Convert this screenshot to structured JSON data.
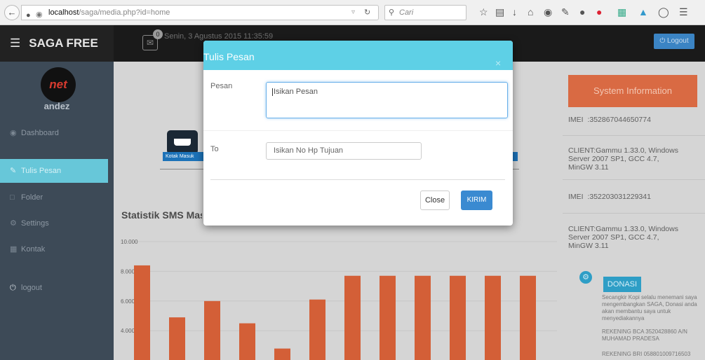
{
  "browser": {
    "url_host": "localhost",
    "url_path": "/saga/media.php?id=home",
    "search_placeholder": "Cari",
    "back_icon": "back-arrow-icon"
  },
  "app": {
    "brand": "SAGA FREE",
    "menu_icon": "hamburger-icon",
    "inbox_badge": "0",
    "datetime": "Senin, 3 Agustus 2015 11:35:59",
    "logout_button": "Logout"
  },
  "sidebar": {
    "user_name": "andez",
    "avatar_text": "net",
    "items": [
      {
        "label": "Dashboard",
        "icon": "dashboard-icon"
      },
      {
        "label": "Tulis Pesan",
        "icon": "edit-icon",
        "active": true
      },
      {
        "label": "Folder",
        "icon": "folder-icon"
      },
      {
        "label": "Settings",
        "icon": "gears-icon"
      },
      {
        "label": "Kontak",
        "icon": "book-icon"
      },
      {
        "label": "logout",
        "icon": "power-icon"
      }
    ]
  },
  "main": {
    "inbox_label": "Kotak Masuk",
    "stat_title": "Statistik SMS Masuk"
  },
  "chart_data": {
    "type": "bar",
    "yticks": [
      "10.000",
      "8.000",
      "6.000",
      "4.000"
    ],
    "ylim": [
      0,
      10000
    ],
    "values": [
      8400,
      4900,
      6000,
      4500,
      2800,
      6100,
      7700,
      7700,
      7700,
      7700,
      7700,
      7700
    ],
    "colors": {
      "bar": "#d35f37",
      "grid": "#c6c6c6"
    }
  },
  "right_panel": {
    "title": "System Information",
    "rows": [
      {
        "label": "IMEI",
        "value": ":352867044650774"
      },
      {
        "label": "CLIENT",
        "value": ":Gammu 1.33.0, Windows Server 2007 SP1, GCC 4.7, MinGW 3.11"
      },
      {
        "label": "IMEI",
        "value": ":352203031229341"
      },
      {
        "label": "CLIENT",
        "value": ":Gammu 1.33.0, Windows Server 2007 SP1, GCC 4.7, MinGW 3.11"
      }
    ],
    "donasi_button": "DONASI",
    "donasi_text": "Secangkir Kopi selalu menemani saya mengembangkan SAGA, Donasi anda akan membantu saya untuk menyediakannya",
    "rekening_1": "REKENING BCA 3520428860 A/N MUHAMAD PRADESA",
    "rekening_2": "REKENING BRI 058801009716503"
  },
  "modal": {
    "title": "Tulis Pesan",
    "close_x": "×",
    "pesan_label": "Pesan",
    "pesan_placeholder": "Isikan Pesan",
    "to_label": "To",
    "to_placeholder": "Isikan No Hp Tujuan",
    "close_button": "Close",
    "send_button": "KIRIM"
  },
  "colors": {
    "accent_cyan": "#5ed0e6",
    "primary_blue": "#3a8ad1",
    "orange": "#d96a43",
    "sidebar_bg": "#3d4a57"
  }
}
